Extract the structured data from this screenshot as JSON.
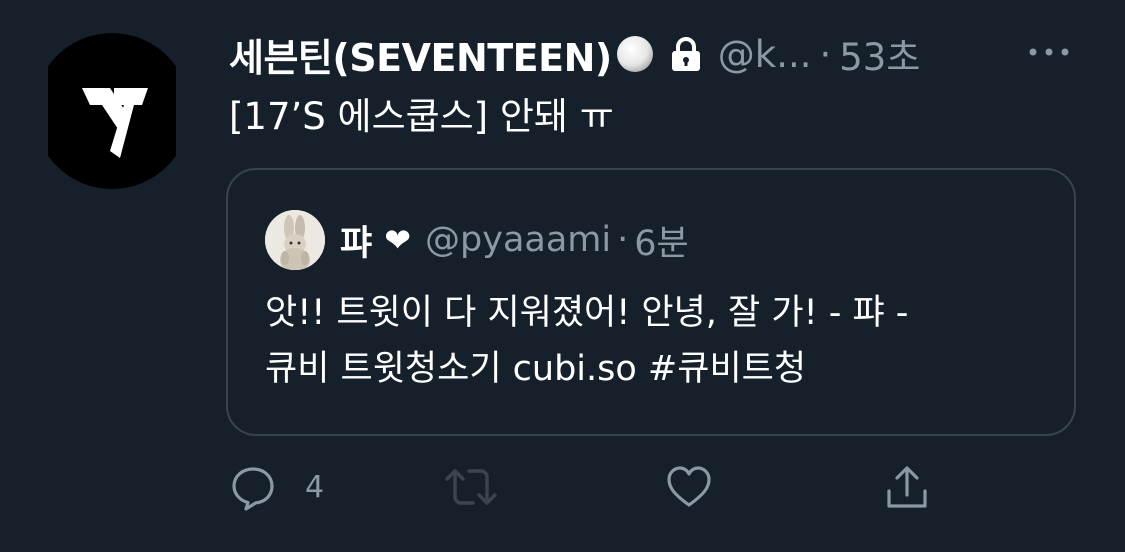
{
  "tweet": {
    "display_name": "세븐틴(SEVENTEEN)",
    "verified_icon": "white-circle-emoji",
    "protected_icon": "lock-icon",
    "handle": "@k...",
    "separator": "·",
    "time": "53초",
    "text": "[17’S 에스쿱스] 안돼 ㅠ"
  },
  "quote": {
    "display_name": "퍄",
    "name_emoji": "❤",
    "handle": "@pyaaami",
    "separator": "·",
    "time": "6분",
    "text_line1": "앗!! 트윗이 다 지워졌어! 안녕, 잘 가! - 퍄 -",
    "text_line2": "큐비 트윗청소기 cubi.so #큐비트청"
  },
  "actions": {
    "reply_icon": "reply-icon",
    "reply_count": "4",
    "retweet_icon": "retweet-icon",
    "like_icon": "heart-icon",
    "share_icon": "share-icon"
  },
  "colors": {
    "background": "#15202b",
    "secondary_text": "#8b98a5",
    "border": "#38444d",
    "retweet_disabled": "#3a4550"
  }
}
